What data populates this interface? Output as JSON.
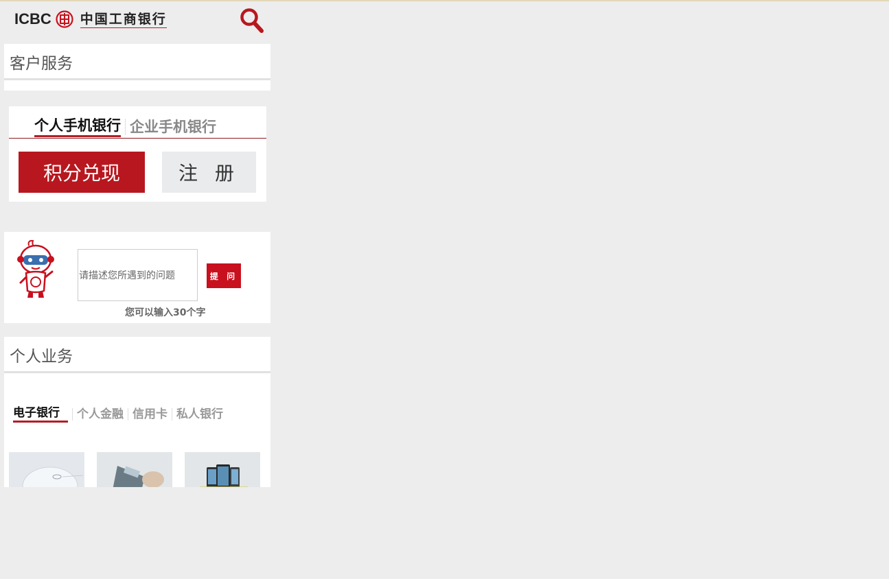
{
  "header": {
    "logo_en": "ICBC",
    "logo_cn": "中国工商银行",
    "search_icon": "search-icon"
  },
  "customer_service": {
    "title": "客户服务",
    "tabs": [
      {
        "label": "个人手机银行",
        "active": true
      },
      {
        "label": "企业手机银行",
        "active": false
      }
    ],
    "primary_button": "积分兑现",
    "secondary_button": "注 册"
  },
  "ask": {
    "placeholder": "请描述您所遇到的问题",
    "submit_label": "提 问",
    "hint": "您可以输入30个字"
  },
  "personal_business": {
    "title": "个人业务",
    "tabs": [
      {
        "label": "电子银行",
        "active": true
      },
      {
        "label": "个人金融",
        "active": false
      },
      {
        "label": "信用卡",
        "active": false
      },
      {
        "label": "私人银行",
        "active": false
      }
    ]
  },
  "colors": {
    "brand_red": "#b8171f",
    "background": "#ededed"
  }
}
